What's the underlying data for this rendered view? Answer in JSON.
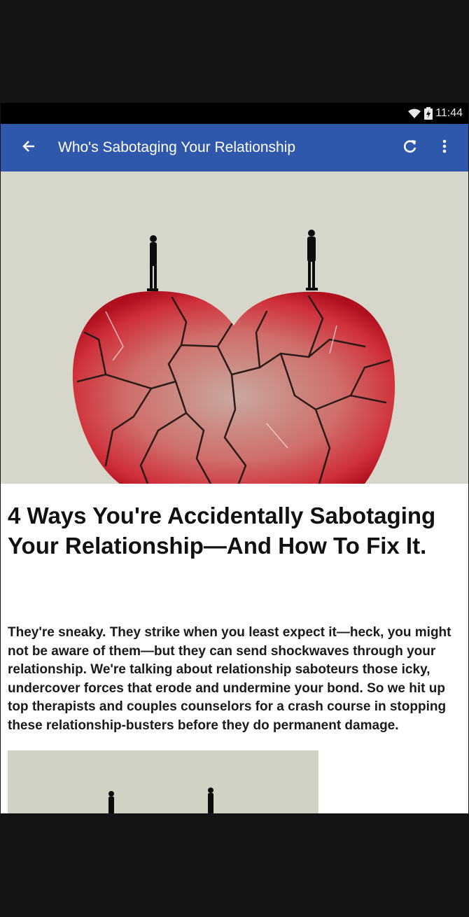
{
  "status_bar": {
    "time": "11:44",
    "wifi_icon": "wifi-icon",
    "battery_icon": "battery-icon"
  },
  "app_bar": {
    "title": "Who's Sabotaging Your Relationship",
    "back_icon": "arrow-left-icon",
    "refresh_icon": "refresh-icon",
    "menu_icon": "more-vert-icon",
    "color": "#2f58ac"
  },
  "article": {
    "headline": "4 Ways You're Accidentally Sabotaging Your Relationship—And How To Fix It.",
    "body": "They're sneaky. They strike when you least expect it—heck, you might not be aware of them—but they can send shockwaves through your relationship. We're talking about relationship saboteurs those icky, undercover forces that erode and undermine your bond. So we hit up top therapists and couples counselors for a crash course in stopping these relationship-busters before they do permanent damage."
  },
  "hero_image": {
    "subject": "cracked red heart with two silhouettes standing on top"
  }
}
